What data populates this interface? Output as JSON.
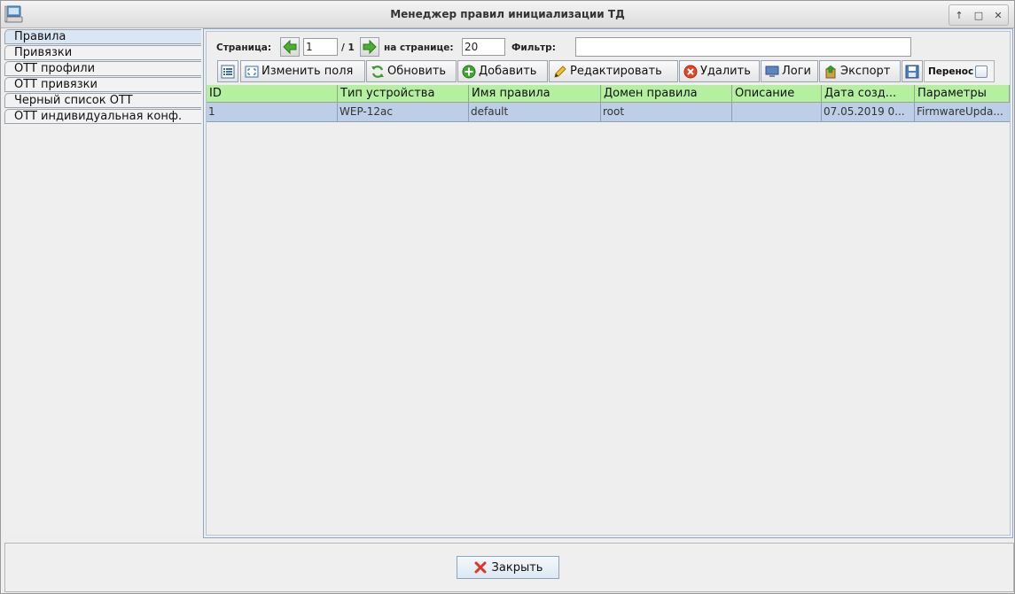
{
  "window": {
    "title": "Менеджер правил инициализации ТД",
    "controls": {
      "up": "↑",
      "maximize": "□",
      "close": "✕"
    }
  },
  "sidebar": {
    "items": [
      {
        "label": "Правила",
        "active": true
      },
      {
        "label": "Привязки"
      },
      {
        "label": "OTT профили"
      },
      {
        "label": "OTT привязки"
      },
      {
        "label": "Черный список OTT"
      },
      {
        "label": "OTT индивидуальная конф."
      }
    ]
  },
  "pager": {
    "page_label": "Страница:",
    "page_value": "1",
    "page_total": "/ 1",
    "per_page_label": "на странице:",
    "per_page_value": "20",
    "filter_label": "Фильтр:",
    "filter_value": ""
  },
  "toolbar": {
    "change_fields": "Изменить поля",
    "refresh": "Обновить",
    "add": "Добавить",
    "edit": "Редактировать",
    "delete": "Удалить",
    "logs": "Логи",
    "export": "Экспорт",
    "wrap_label": "Перенос"
  },
  "table": {
    "columns": [
      "ID",
      "Тип устройства",
      "Имя правила",
      "Домен правила",
      "Описание",
      "Дата созд...",
      "Параметры"
    ],
    "rows": [
      [
        "1",
        "WEP-12ac",
        "default",
        "root",
        "",
        "07.05.2019 0...",
        "FirmwareUpda..."
      ]
    ]
  },
  "footer": {
    "close_label": "Закрыть"
  },
  "colors": {
    "header_bg": "#b4f0a0",
    "selected_row": "#bccfe6",
    "active_nav": "#d9e6f4"
  }
}
